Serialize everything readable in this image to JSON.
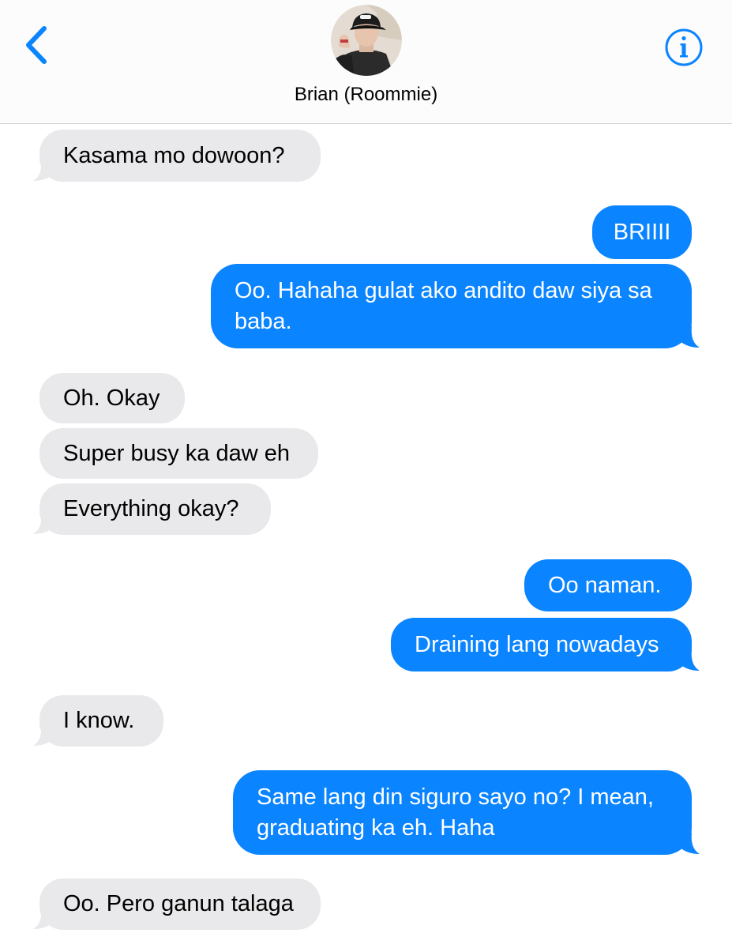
{
  "header": {
    "contact_name": "Brian (Roommie)",
    "back_icon": "chevron-left-icon",
    "info_icon": "info-icon",
    "accent_color": "#0a84ff"
  },
  "messages": [
    {
      "id": "m1",
      "sender": "contact",
      "text": "Kasama mo dowoon?"
    },
    {
      "id": "m2",
      "sender": "me",
      "text": "BRIIII"
    },
    {
      "id": "m3",
      "sender": "me",
      "text": "Oo. Hahaha gulat ako andito daw siya sa baba."
    },
    {
      "id": "m4",
      "sender": "contact",
      "text": "Oh. Okay"
    },
    {
      "id": "m5",
      "sender": "contact",
      "text": "Super busy ka daw eh"
    },
    {
      "id": "m6",
      "sender": "contact",
      "text": "Everything okay?"
    },
    {
      "id": "m7",
      "sender": "me",
      "text": "Oo naman."
    },
    {
      "id": "m8",
      "sender": "me",
      "text": "Draining lang nowadays"
    },
    {
      "id": "m9",
      "sender": "contact",
      "text": "I know."
    },
    {
      "id": "m10",
      "sender": "me",
      "text": "Same lang din siguro sayo no? I mean, graduating ka eh. Haha"
    },
    {
      "id": "m11",
      "sender": "contact",
      "text": "Oo. Pero ganun talaga"
    }
  ],
  "colors": {
    "incoming_bubble": "#e9e9eb",
    "outgoing_bubble": "#0a84ff"
  }
}
